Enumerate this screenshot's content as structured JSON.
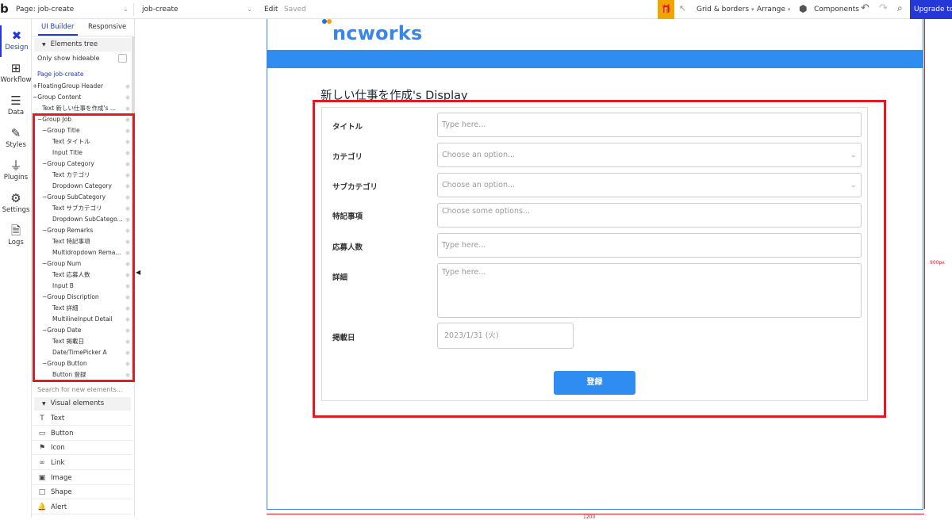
{
  "topbar": {
    "logo": "b",
    "page_select": "Page: job-create",
    "element_select": "job-create",
    "edit": "Edit",
    "saved": "Saved",
    "grid": "Grid & borders",
    "arrange": "Arrange",
    "components": "Components",
    "upgrade": "Upgrade to"
  },
  "rail": [
    {
      "label": "Design"
    },
    {
      "label": "Workflow"
    },
    {
      "label": "Data"
    },
    {
      "label": "Styles"
    },
    {
      "label": "Plugins"
    },
    {
      "label": "Settings"
    },
    {
      "label": "Logs"
    }
  ],
  "panel": {
    "tab_ui": "UI Builder",
    "tab_responsive": "Responsive",
    "elements_tree": "Elements tree",
    "only_hideable": "Only show hideable",
    "page_link": "Page job-create",
    "tree": [
      "+FloatingGroup Header",
      "−Group Content",
      "Text 新しい仕事を作成's ...",
      "−Group Job",
      "−Group Title",
      "Text タイトル",
      "Input Title",
      "−Group Category",
      "Text カテゴリ",
      "Dropdown Category",
      "−Group SubCategory",
      "Text サブカテゴリ",
      "Dropdown SubCatego...",
      "−Group Remarks",
      "Text 特記事項",
      "Multidropdown Rema...",
      "−Group Num",
      "Text 応募人数",
      "Input B",
      "−Group Discription",
      "Text 詳細",
      "MultilineInput Detail",
      "−Group Date",
      "Text 掲載日",
      "Date/TimePicker A",
      "−Group Button",
      "Button 登録"
    ],
    "search_placeholder": "Search for new elements...",
    "visual_elements": "Visual elements",
    "visual_items": [
      "Text",
      "Button",
      "Icon",
      "Link",
      "Image",
      "Shape",
      "Alert"
    ]
  },
  "canvas": {
    "brand": "ncworks",
    "heading": "新しい仕事を作成's Display",
    "width_label": "1200",
    "height_label": "900px",
    "form": {
      "title_label": "タイトル",
      "title_placeholder": "Type here...",
      "category_label": "カテゴリ",
      "category_placeholder": "Choose an option...",
      "subcategory_label": "サブカテゴリ",
      "subcategory_placeholder": "Choose an option...",
      "remarks_label": "特記事項",
      "remarks_placeholder": "Choose some options...",
      "num_label": "応募人数",
      "num_placeholder": "Type here...",
      "detail_label": "詳細",
      "detail_placeholder": "Type here...",
      "date_label": "掲載日",
      "date_value": "2023/1/31 (火)",
      "submit": "登録"
    }
  }
}
